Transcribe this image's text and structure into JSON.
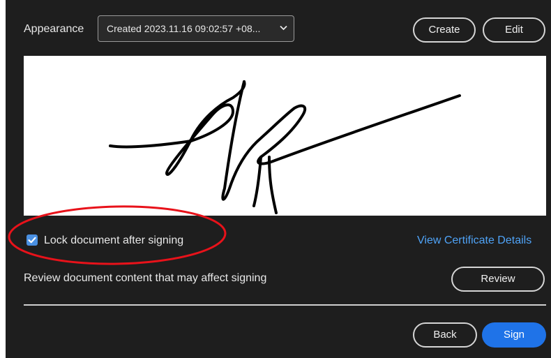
{
  "appearance": {
    "label": "Appearance",
    "selected_value": "Created 2023.11.16 09:02:57 +08..."
  },
  "toolbar": {
    "create_label": "Create",
    "edit_label": "Edit"
  },
  "signature": {
    "icon": "handwritten-signature"
  },
  "lock_option": {
    "label": "Lock document after signing",
    "checked": true
  },
  "certificate_link": "View Certificate Details",
  "review": {
    "text": "Review document content that may affect signing",
    "button_label": "Review"
  },
  "footer": {
    "back_label": "Back",
    "sign_label": "Sign"
  },
  "colors": {
    "background": "#1e1e1e",
    "accent": "#1f73e8",
    "link": "#4fa3f7",
    "annotation": "#e8121a"
  }
}
